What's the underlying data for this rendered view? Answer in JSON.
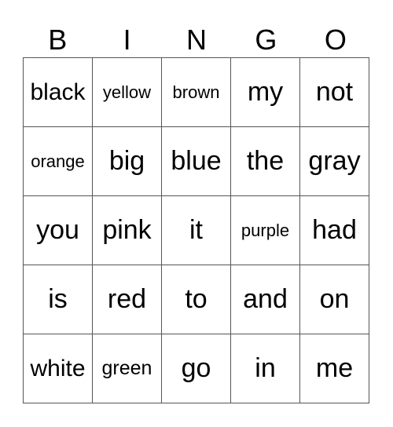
{
  "header": [
    "B",
    "I",
    "N",
    "G",
    "O"
  ],
  "cells": [
    [
      "black",
      "yellow",
      "brown",
      "my",
      "not"
    ],
    [
      "orange",
      "big",
      "blue",
      "the",
      "gray"
    ],
    [
      "you",
      "pink",
      "it",
      "purple",
      "had"
    ],
    [
      "is",
      "red",
      "to",
      "and",
      "on"
    ],
    [
      "white",
      "green",
      "go",
      "in",
      "me"
    ]
  ]
}
